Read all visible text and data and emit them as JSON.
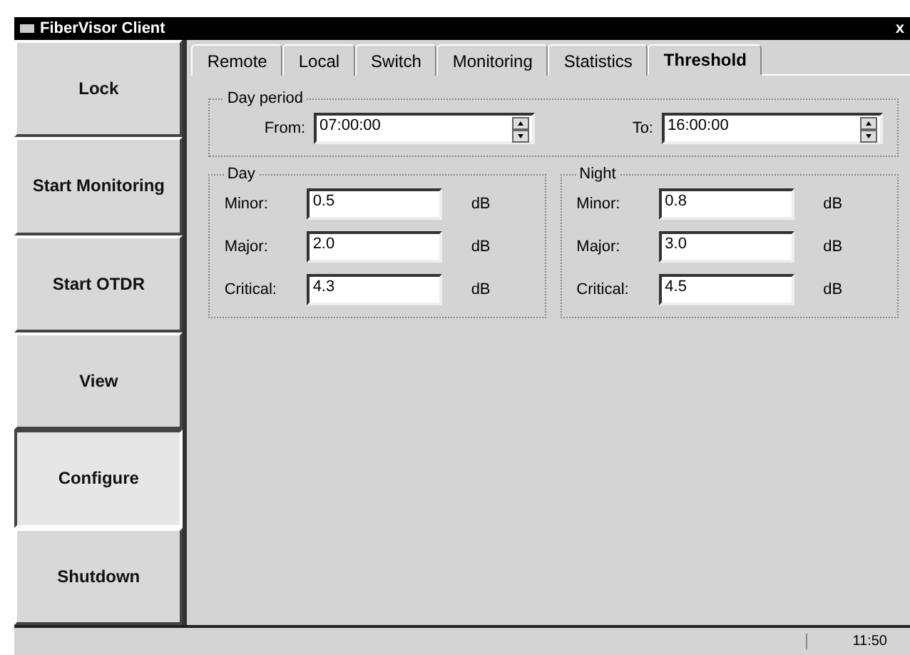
{
  "window": {
    "title": "FiberVisor Client",
    "close": "x"
  },
  "sidebar": {
    "buttons": [
      {
        "label": "Lock",
        "selected": false
      },
      {
        "label": "Start Monitoring",
        "selected": false
      },
      {
        "label": "Start OTDR",
        "selected": false
      },
      {
        "label": "View",
        "selected": false
      },
      {
        "label": "Configure",
        "selected": true
      },
      {
        "label": "Shutdown",
        "selected": false
      }
    ]
  },
  "tabs": [
    {
      "label": "Remote",
      "selected": false
    },
    {
      "label": "Local",
      "selected": false
    },
    {
      "label": "Switch",
      "selected": false
    },
    {
      "label": "Monitoring",
      "selected": false
    },
    {
      "label": "Statistics",
      "selected": false
    },
    {
      "label": "Threshold",
      "selected": true
    }
  ],
  "day_period": {
    "title": "Day period",
    "from": {
      "label": "From:",
      "value": "07:00:00"
    },
    "to": {
      "label": "To:",
      "value": "16:00:00"
    }
  },
  "groups": [
    {
      "title": "Day",
      "rows": [
        {
          "label": "Minor:",
          "value": "0.5",
          "unit": "dB"
        },
        {
          "label": "Major:",
          "value": "2.0",
          "unit": "dB"
        },
        {
          "label": "Critical:",
          "value": "4.3",
          "unit": "dB"
        }
      ]
    },
    {
      "title": "Night",
      "rows": [
        {
          "label": "Minor:",
          "value": "0.8",
          "unit": "dB"
        },
        {
          "label": "Major:",
          "value": "3.0",
          "unit": "dB"
        },
        {
          "label": "Critical:",
          "value": "4.5",
          "unit": "dB"
        }
      ]
    }
  ],
  "status_bar": {
    "time": "11:50"
  }
}
